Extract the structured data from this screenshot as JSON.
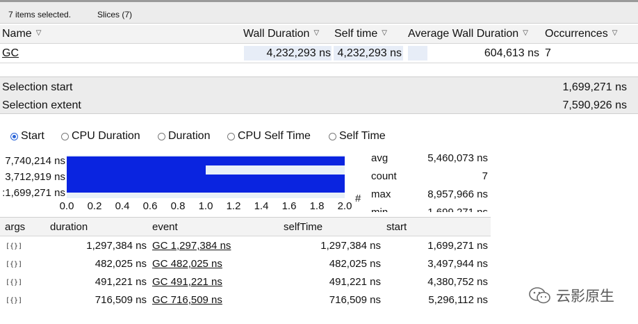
{
  "topbar": {
    "selected": "7 items selected.",
    "tab": "Slices (7)"
  },
  "slices_table": {
    "headers": {
      "name": "Name",
      "wall": "Wall Duration",
      "self": "Self time",
      "avg": "Average Wall Duration",
      "occ": "Occurrences"
    },
    "row": {
      "name": "GC",
      "wall": "4,232,293 ns",
      "self": "4,232,293 ns",
      "avg": "604,613 ns",
      "occ": "7"
    }
  },
  "selection": {
    "start_label": "Selection start",
    "start_value": "1,699,271 ns",
    "extent_label": "Selection extent",
    "extent_value": "7,590,926 ns"
  },
  "radio_options": {
    "start": "Start",
    "cpu_duration": "CPU Duration",
    "duration": "Duration",
    "cpu_self": "CPU Self Time",
    "self": "Self Time",
    "selected": "Start"
  },
  "chart_data": {
    "type": "bar",
    "orientation": "horizontal",
    "categories": [
      "7,740,214 ns",
      "3,712,919 ns",
      ":1,699,271 ns"
    ],
    "values": [
      2.0,
      1.0,
      2.0,
      2.0
    ],
    "xlim": [
      0,
      2.0
    ],
    "xticks": [
      "0.0",
      "0.2",
      "0.4",
      "0.6",
      "0.8",
      "1.0",
      "1.2",
      "1.4",
      "1.6",
      "1.8",
      "2.0"
    ],
    "xlabel": "#",
    "bar_color": "#0a24e0"
  },
  "stats": [
    {
      "label": "avg",
      "value": "5,460,073 ns"
    },
    {
      "label": "count",
      "value": "7"
    },
    {
      "label": "max",
      "value": "8,957,966 ns"
    },
    {
      "label": "min",
      "value": "1,699,271 ns"
    }
  ],
  "events_table": {
    "headers": {
      "args": "args",
      "duration": "duration",
      "event": "event",
      "selfTime": "selfTime",
      "start": "start"
    },
    "rows": [
      {
        "args": "[{}]",
        "duration": "1,297,384 ns",
        "event": "GC 1,297,384 ns",
        "selfTime": "1,297,384 ns",
        "start": "1,699,271 ns"
      },
      {
        "args": "[{}]",
        "duration": "482,025 ns",
        "event": "GC 482,025 ns",
        "selfTime": "482,025 ns",
        "start": "3,497,944 ns"
      },
      {
        "args": "[{}]",
        "duration": "491,221 ns",
        "event": "GC 491,221 ns",
        "selfTime": "491,221 ns",
        "start": "4,380,752 ns"
      },
      {
        "args": "[{}]",
        "duration": "716,509 ns",
        "event": "GC 716,509 ns",
        "selfTime": "716,509 ns",
        "start": "5,296,112 ns"
      }
    ]
  },
  "watermark": {
    "text": "云影原生",
    "icon": "wechat-icon"
  }
}
